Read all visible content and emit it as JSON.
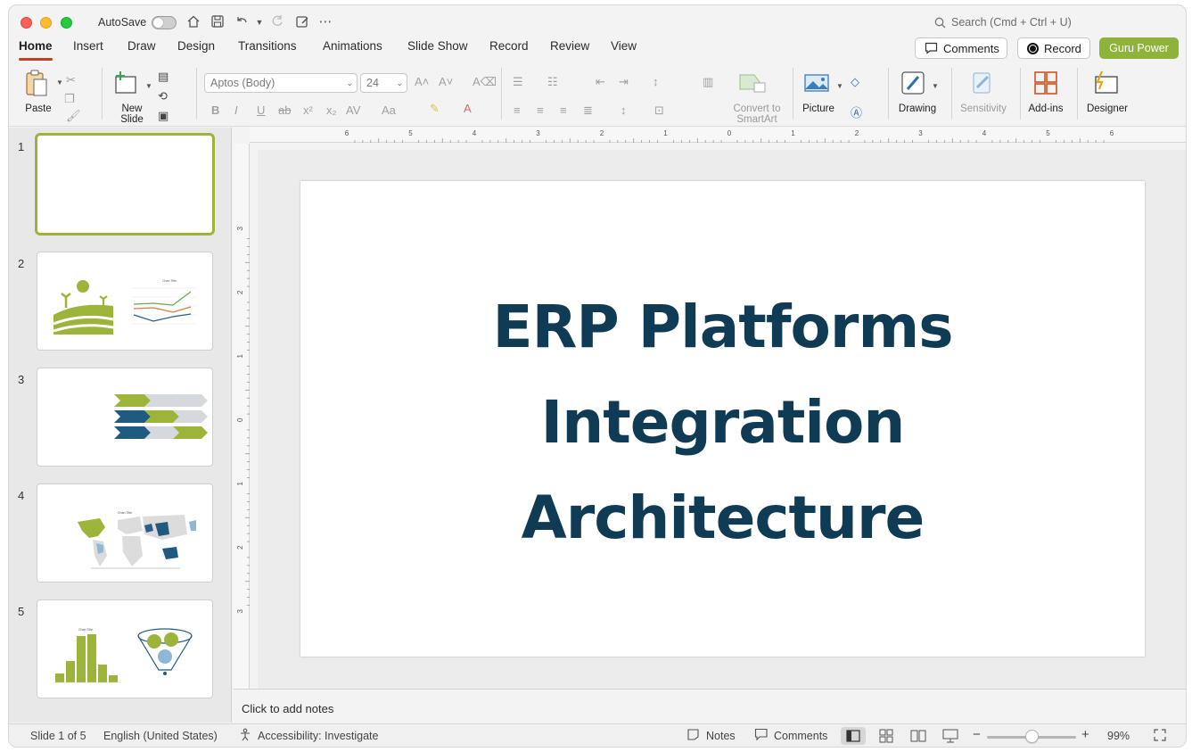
{
  "window": {
    "autosave_label": "AutoSave",
    "search_placeholder": "Search (Cmd + Ctrl + U)"
  },
  "tabs": [
    "Home",
    "Insert",
    "Draw",
    "Design",
    "Transitions",
    "Animations",
    "Slide Show",
    "Record",
    "Review",
    "View"
  ],
  "active_tab": "Home",
  "header_buttons": {
    "comments": "Comments",
    "record": "Record",
    "guru": "Guru Power"
  },
  "ribbon": {
    "paste": "Paste",
    "new_slide_line1": "New",
    "new_slide_line2": "Slide",
    "font_name": "Aptos (Body)",
    "font_size": "24",
    "convert_line1": "Convert to",
    "convert_line2": "SmartArt",
    "picture": "Picture",
    "drawing": "Drawing",
    "sensitivity": "Sensitivity",
    "addins": "Add-ins",
    "designer": "Designer"
  },
  "slides": [
    {
      "number": "1"
    },
    {
      "number": "2",
      "mini_chart_title": "Chart Title"
    },
    {
      "number": "3"
    },
    {
      "number": "4",
      "mini_chart_title": "Chart Title"
    },
    {
      "number": "5",
      "mini_chart_title": "Chart Title"
    }
  ],
  "ruler_top": [
    "6",
    "5",
    "4",
    "3",
    "2",
    "1",
    "0",
    "1",
    "2",
    "3",
    "4",
    "5",
    "6"
  ],
  "ruler_left": [
    "3",
    "2",
    "1",
    "0",
    "1",
    "2",
    "3"
  ],
  "slide": {
    "title_line1": "ERP Platforms",
    "title_line2": "Integration",
    "title_line3": "Architecture"
  },
  "notes_placeholder": "Click to add notes",
  "status": {
    "slide_counter": "Slide 1 of 5",
    "language": "English (United States)",
    "accessibility": "Accessibility: Investigate",
    "notes": "Notes",
    "comments": "Comments",
    "zoom": "99%"
  },
  "colors": {
    "accent": "#c43e1c",
    "brand_green": "#8db33a",
    "title_navy": "#0f3b55",
    "thumb_selected": "#9cb43a"
  }
}
